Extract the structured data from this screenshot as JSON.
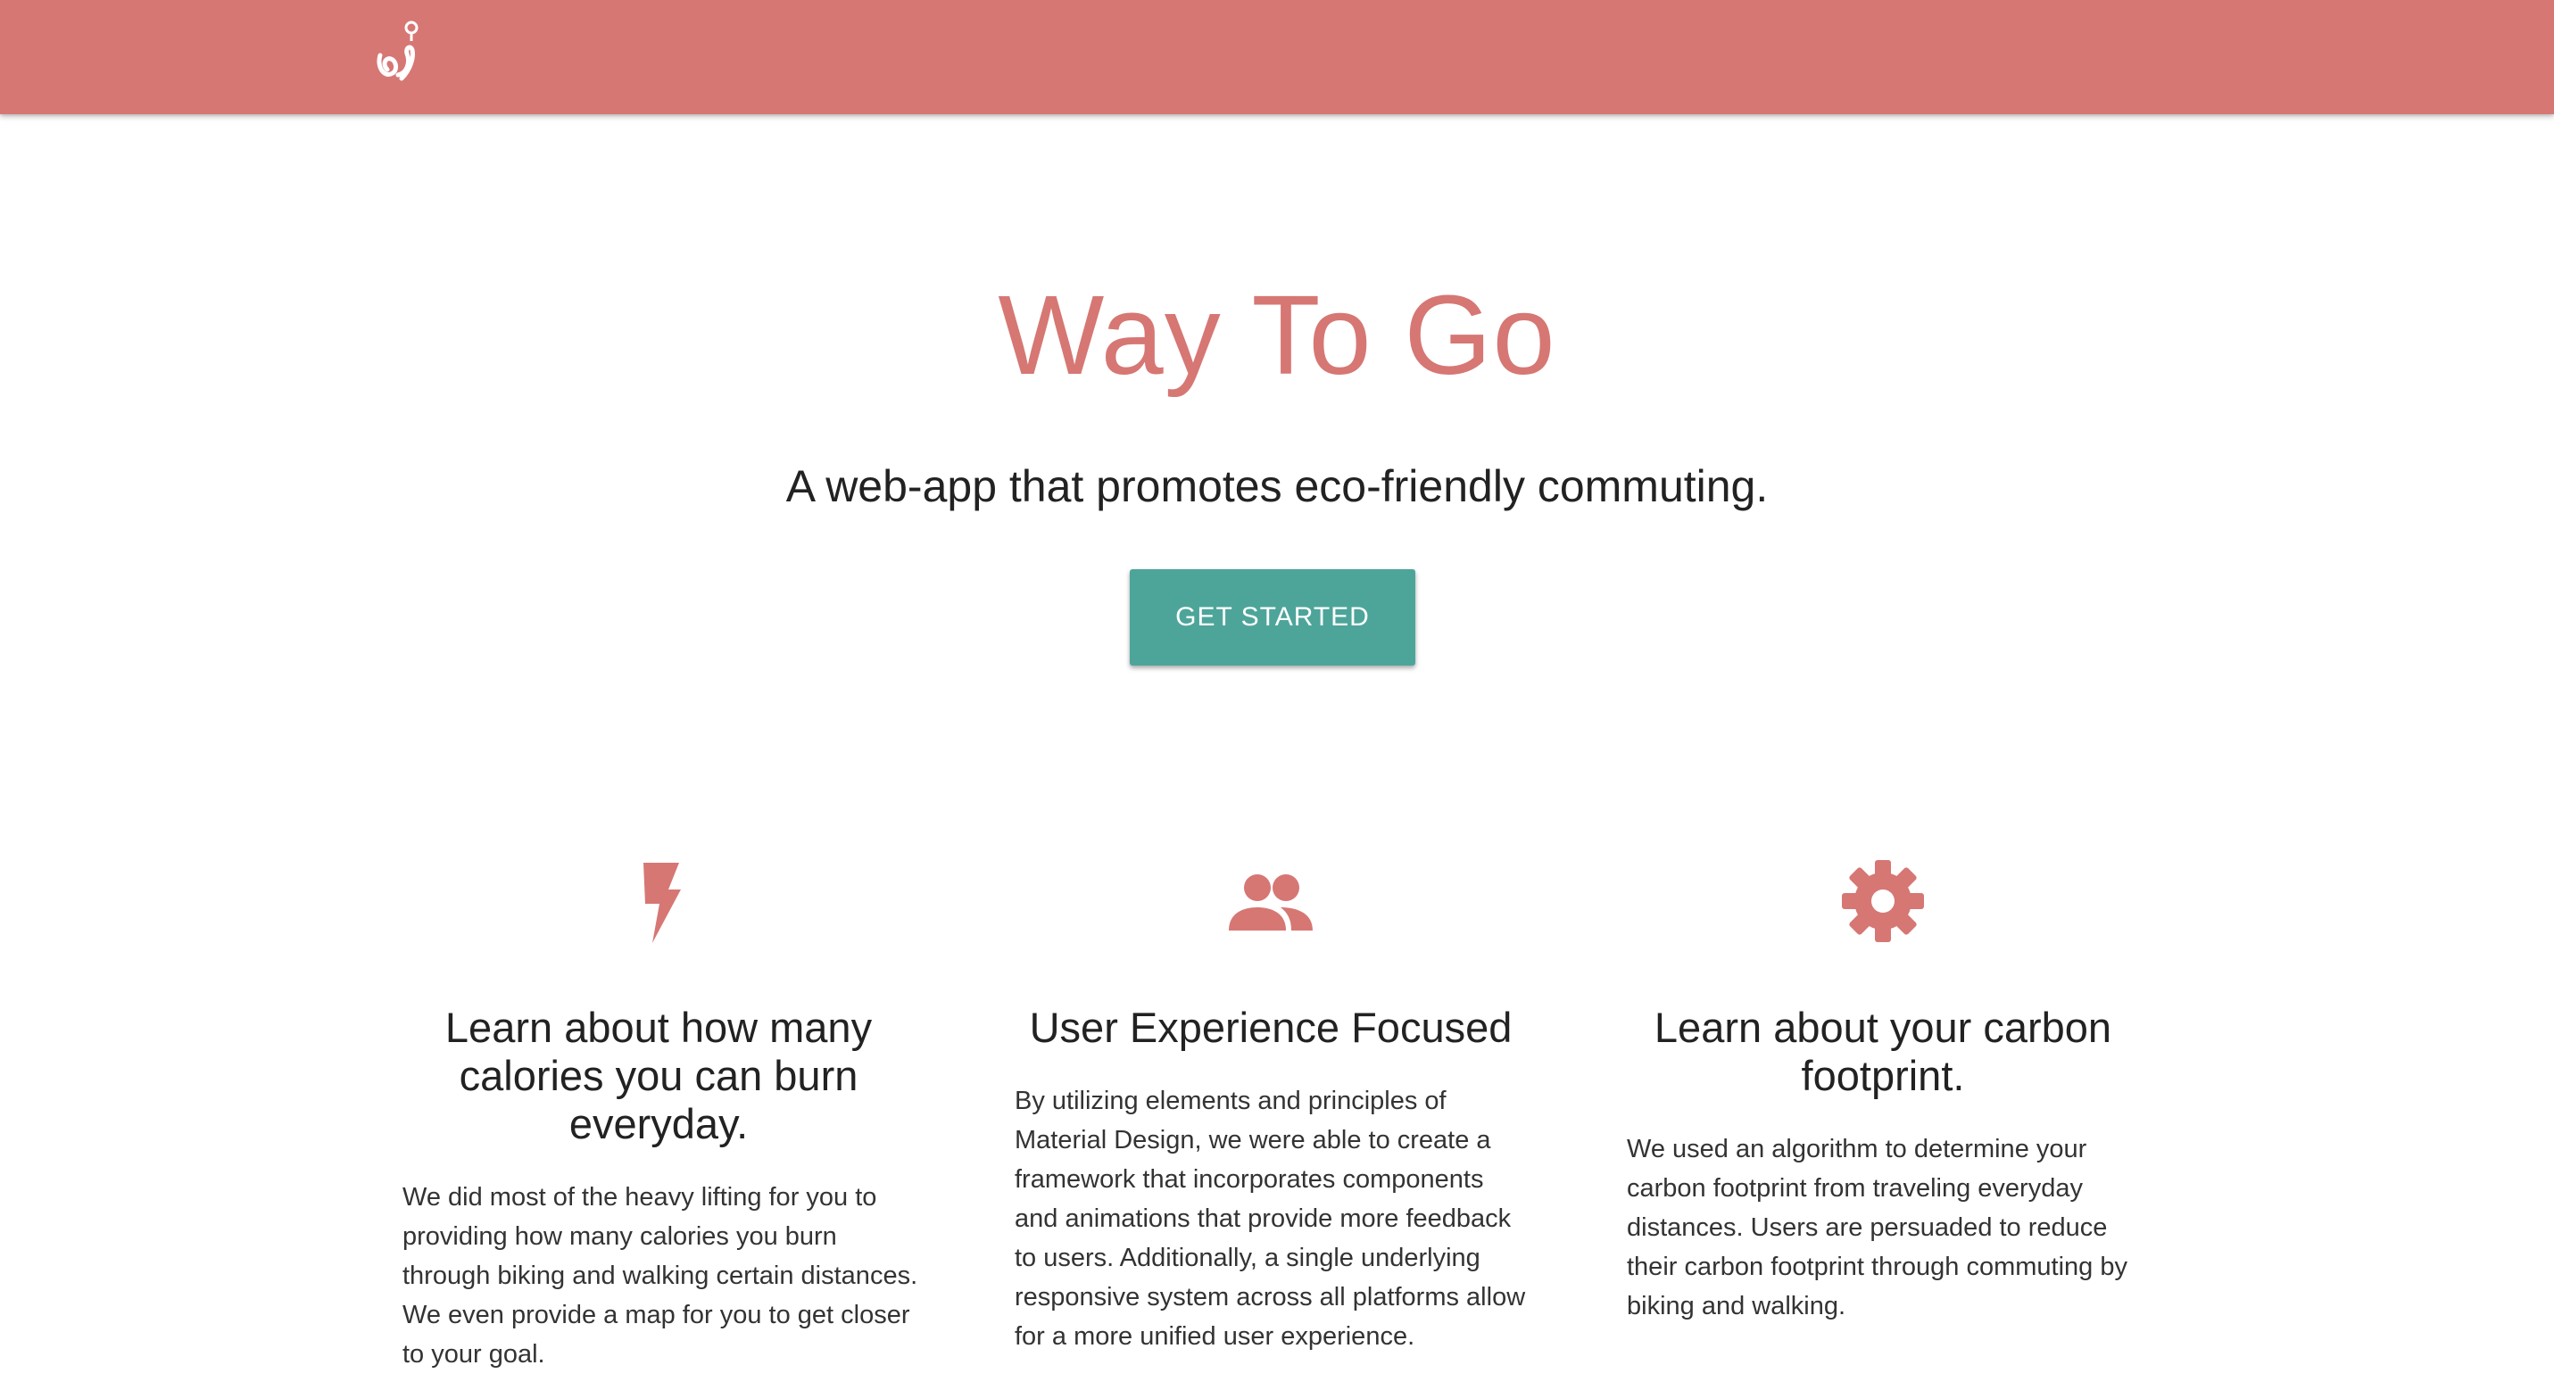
{
  "navbar": {
    "logo_icon": "way-to-go-logo-icon",
    "background_color": "#d67774"
  },
  "hero": {
    "title": "Way To Go",
    "subtitle": "A web-app that promotes eco-friendly commuting.",
    "cta_label": "GET STARTED",
    "accent_color": "#d67774",
    "button_color": "#4da59a"
  },
  "features": [
    {
      "icon": "bolt-icon",
      "title": "Learn about how many calories you can burn everyday.",
      "body": "We did most of the heavy lifting for you to providing how many calories you burn through biking and walking certain distances. We even provide a map for you to get closer to your goal."
    },
    {
      "icon": "group-icon",
      "title": "User Experience Focused",
      "body": "By utilizing elements and principles of Material Design, we were able to create a framework that incorporates components and animations that provide more feedback to users. Additionally, a single underlying responsive system across all platforms allow for a more unified user experience."
    },
    {
      "icon": "gear-icon",
      "title": "Learn about your carbon footprint.",
      "body": "We used an algorithm to determine your carbon footprint from traveling everyday distances. Users are persuaded to reduce their carbon footprint through commuting by biking and walking."
    }
  ]
}
